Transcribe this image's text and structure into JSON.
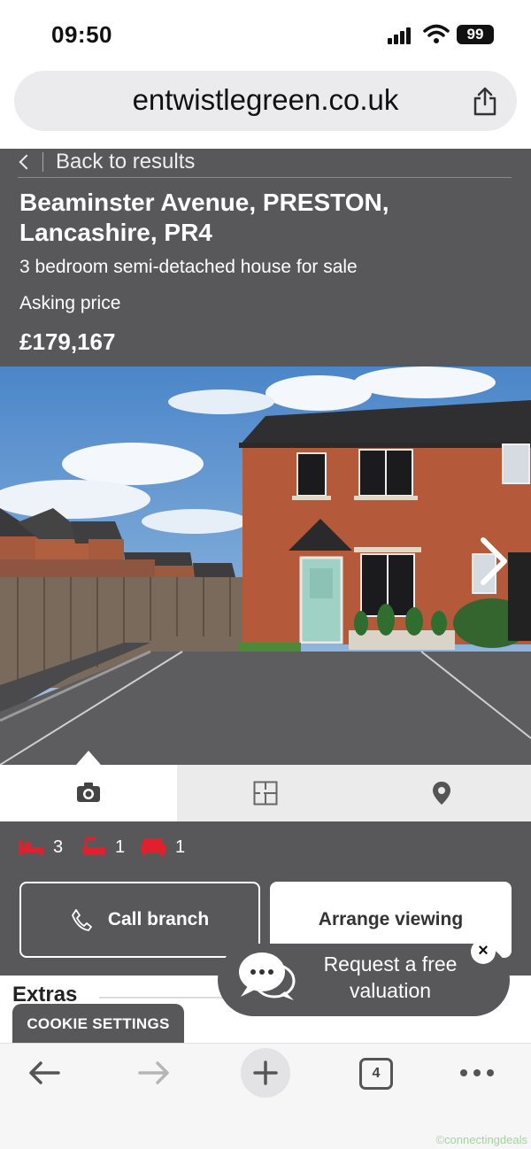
{
  "status_bar": {
    "time": "09:50",
    "battery": "99"
  },
  "browser": {
    "url": "entwistlegreen.co.uk",
    "open_tabs": "4"
  },
  "listing": {
    "back_label": "Back to results",
    "title": "Beaminster Avenue, PRESTON, Lancashire, PR4",
    "subtitle": "3 bedroom semi-detached house for sale",
    "price_label": "Asking price",
    "price": "£179,167"
  },
  "media_tabs": [
    "camera-icon",
    "floorplan-icon",
    "map-pin-icon"
  ],
  "features": {
    "bedrooms": "3",
    "bathrooms": "1",
    "receptions": "1"
  },
  "actions": {
    "call": "Call branch",
    "view": "Arrange viewing"
  },
  "extras_label": "Extras",
  "cookie_label": "COOKIE SETTINGS",
  "valuation": {
    "line1": "Request a free",
    "line2": "valuation",
    "close": "×"
  },
  "watermark": "©connectingdeals",
  "colors": {
    "panel": "#58575a",
    "accent": "#e0202d"
  }
}
